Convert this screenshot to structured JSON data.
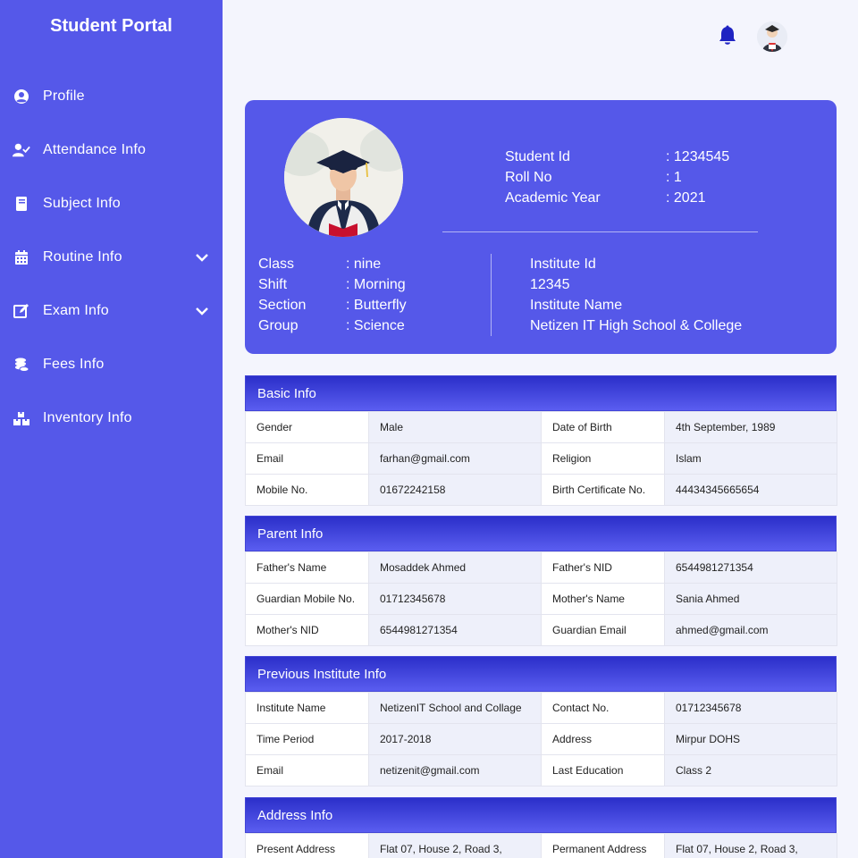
{
  "sidebar": {
    "brand": "Student Portal",
    "items": [
      {
        "label": "Profile",
        "icon": "user-circle-icon"
      },
      {
        "label": "Attendance Info",
        "icon": "user-check-icon"
      },
      {
        "label": "Subject Info",
        "icon": "book-icon"
      },
      {
        "label": "Routine Info",
        "icon": "calendar-icon",
        "expandable": true
      },
      {
        "label": "Exam Info",
        "icon": "edit-icon",
        "expandable": true
      },
      {
        "label": "Fees Info",
        "icon": "coins-icon"
      },
      {
        "label": "Inventory Info",
        "icon": "boxes-icon"
      }
    ]
  },
  "topbar": {
    "notification_icon": "bell-icon",
    "avatar_icon": "avatar"
  },
  "profile": {
    "top": [
      {
        "k": "Student Id",
        "v": ": 1234545"
      },
      {
        "k": "Roll No",
        "v": ": 1"
      },
      {
        "k": "Academic Year",
        "v": ": 2021"
      }
    ],
    "left": [
      {
        "k": "Class",
        "v": ": nine"
      },
      {
        "k": "Shift",
        "v": ": Morning"
      },
      {
        "k": "Section",
        "v": ": Butterfly"
      },
      {
        "k": "Group",
        "v": ": Science"
      }
    ],
    "right": [
      "Institute Id",
      "12345",
      "Institute Name",
      "Netizen IT High School & College"
    ]
  },
  "sections": [
    {
      "title": "Basic Info",
      "rows": [
        [
          "Gender",
          "Male",
          "Date of Birth",
          "4th September, 1989"
        ],
        [
          "Email",
          "farhan@gmail.com",
          "Religion",
          "Islam"
        ],
        [
          "Mobile No.",
          "01672242158",
          "Birth Certificate No.",
          "44434345665654"
        ]
      ]
    },
    {
      "title": "Parent Info",
      "rows": [
        [
          "Father's Name",
          "Mosaddek Ahmed",
          "Father's NID",
          "6544981271354"
        ],
        [
          "Guardian Mobile No.",
          "01712345678",
          "Mother's Name",
          "Sania Ahmed"
        ],
        [
          "Mother's NID",
          "6544981271354",
          "Guardian Email",
          "ahmed@gmail.com"
        ]
      ]
    },
    {
      "title": "Previous Institute Info",
      "rows": [
        [
          "Institute Name",
          "NetizenIT School and Collage",
          "Contact No.",
          "01712345678"
        ],
        [
          "Time Period",
          "2017-2018",
          "Address",
          "Mirpur DOHS"
        ],
        [
          "Email",
          "netizenit@gmail.com",
          "Last Education",
          "Class 2"
        ]
      ]
    },
    {
      "title": "Address Info",
      "rows": [
        [
          "Present Address",
          "Flat 07, House 2, Road 3,",
          "Permanent Address",
          "Flat 07, House 2, Road 3,"
        ]
      ]
    }
  ],
  "colors": {
    "primary": "#5558e9",
    "header_dark": "#2b2fc9",
    "bell": "#1f23c2"
  }
}
